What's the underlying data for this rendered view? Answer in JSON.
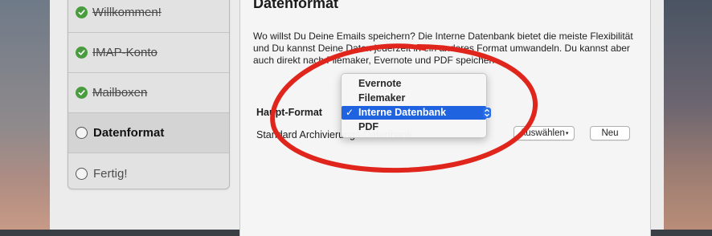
{
  "wizard": {
    "steps": [
      {
        "label": "Willkommen!",
        "state": "done"
      },
      {
        "label": "IMAP-Konto",
        "state": "done"
      },
      {
        "label": "Mailboxen",
        "state": "done"
      },
      {
        "label": "Datenformat",
        "state": "active"
      },
      {
        "label": "Fertig!",
        "state": "pending"
      }
    ]
  },
  "main": {
    "title": "Datenformat",
    "description": "Wo willst Du Deine Emails speichern? Die Interne Datenbank bietet die meiste Flexibilität und Du kannst Deine Daten jederzeit in ein anderes Format umwandeln. Du kannst aber auch direkt nach Filemaker, Evernote und PDF speichern.",
    "format_label": "Haupt-Format",
    "archive_label": "Standard Archivierungs-Datenbank:",
    "select_button": "Auswählen",
    "new_button": "Neu"
  },
  "format_menu": {
    "options": [
      "Evernote",
      "Filemaker",
      "Interne Datenbank",
      "PDF"
    ],
    "selected": "Interne Datenbank",
    "check_glyph": "✓"
  },
  "colors": {
    "annotation": "#e0261c",
    "selection": "#1f63e0",
    "check": "#4a9d3e"
  }
}
